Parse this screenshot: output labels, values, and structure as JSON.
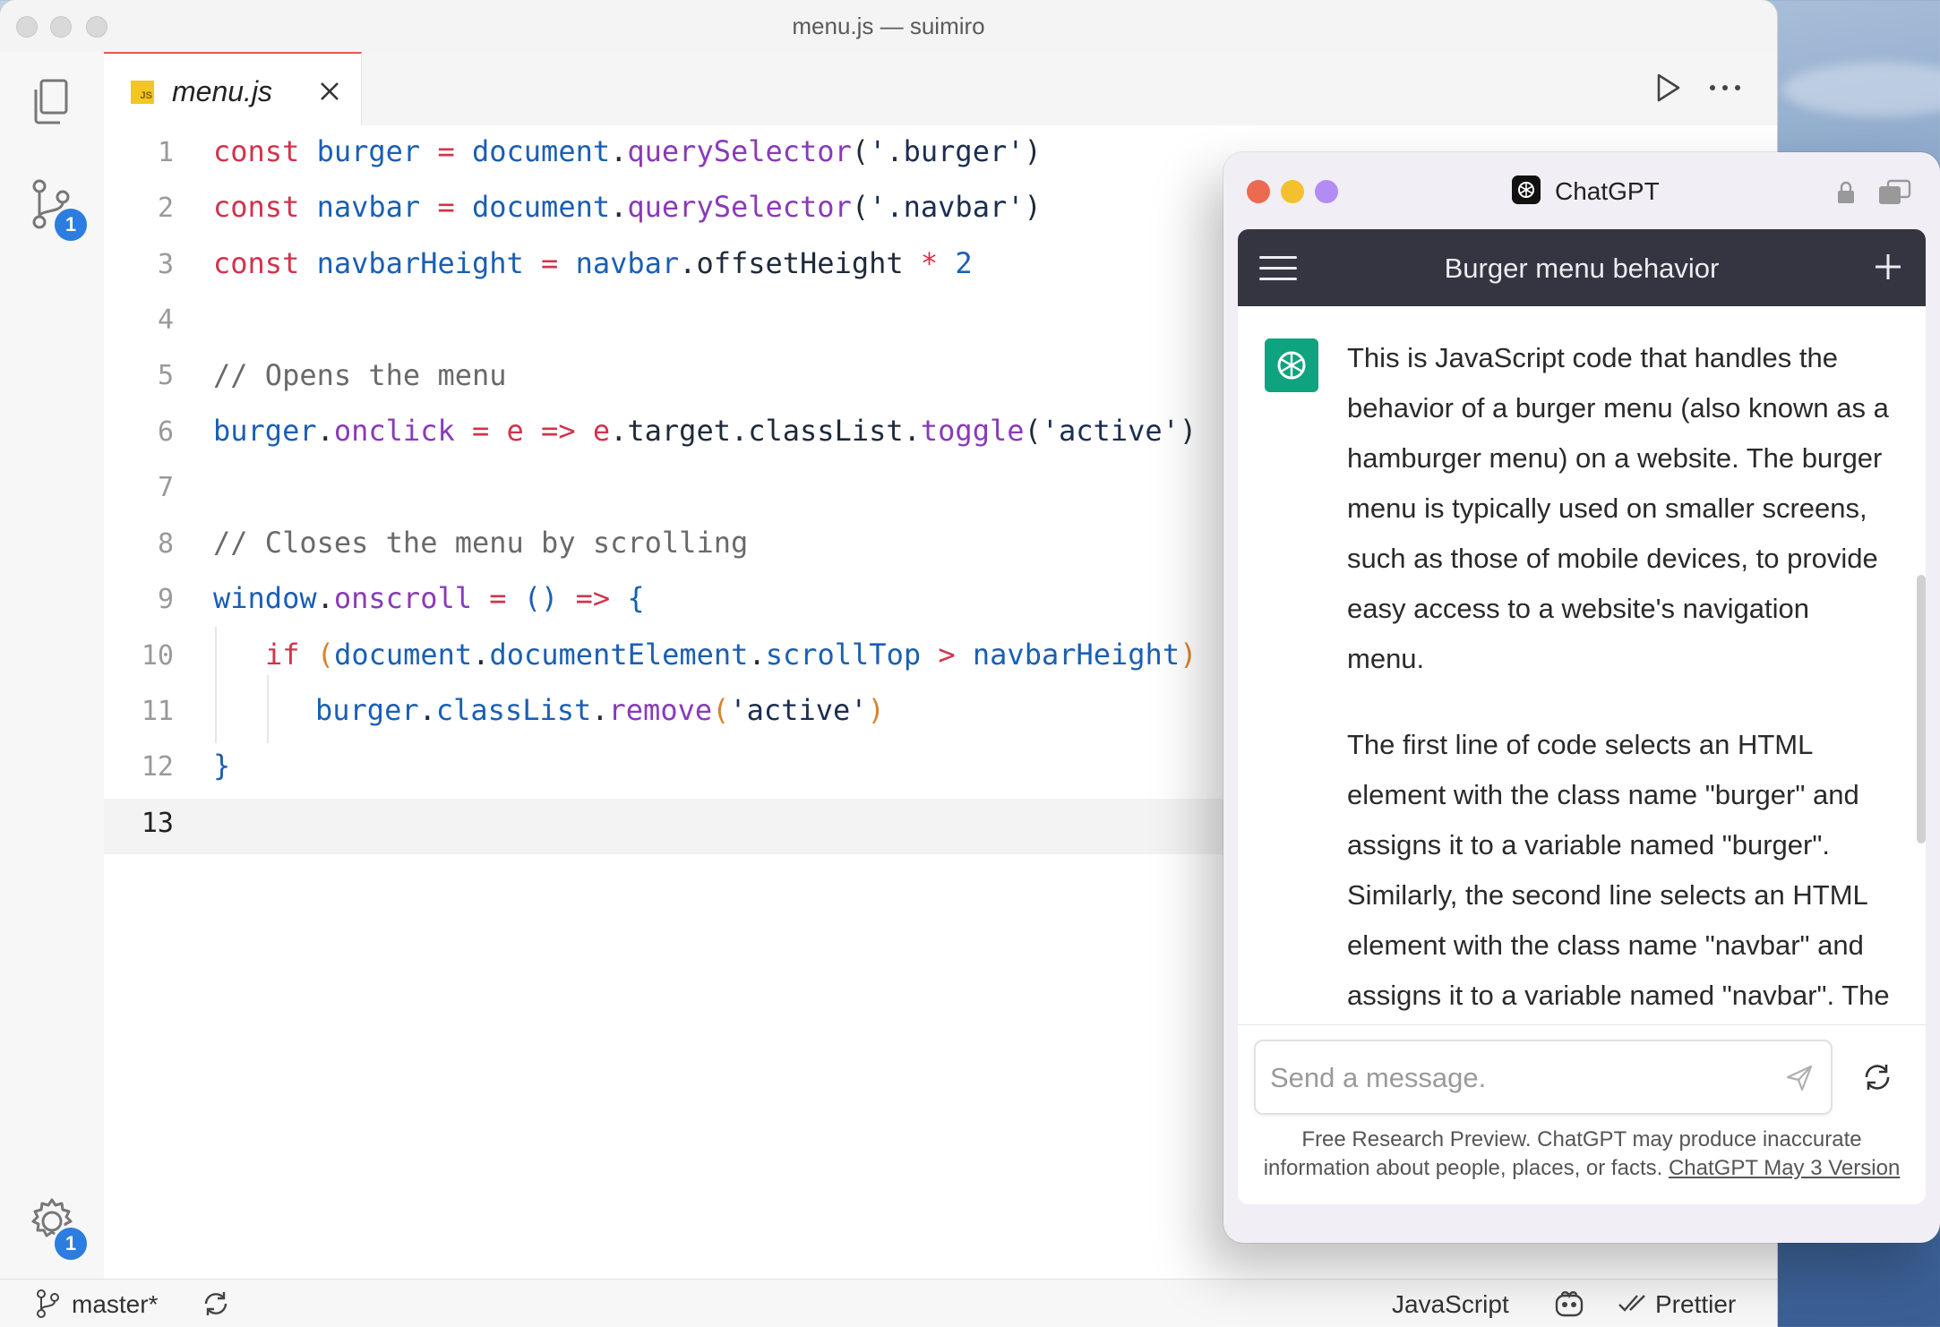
{
  "editor": {
    "window_title": "menu.js — suimiro",
    "tab": {
      "label": "menu.js",
      "lang_badge": "JS"
    },
    "activity_badges": {
      "source_control": "1",
      "settings": "1"
    },
    "lines": [
      {
        "n": "1"
      },
      {
        "n": "2"
      },
      {
        "n": "3"
      },
      {
        "n": "4"
      },
      {
        "n": "5"
      },
      {
        "n": "6"
      },
      {
        "n": "7"
      },
      {
        "n": "8"
      },
      {
        "n": "9"
      },
      {
        "n": "10"
      },
      {
        "n": "11"
      },
      {
        "n": "12"
      },
      {
        "n": "13"
      }
    ],
    "code": {
      "l1": [
        "const",
        "burger",
        "=",
        "document",
        ".",
        "querySelector",
        "(",
        "'.burger'",
        ")"
      ],
      "l2": [
        "const",
        "navbar",
        "=",
        "document",
        ".",
        "querySelector",
        "(",
        "'.navbar'",
        ")"
      ],
      "l3": [
        "const",
        "navbarHeight",
        "=",
        "navbar",
        ".offsetHeight",
        "*",
        "2"
      ],
      "l5": "// Opens the menu",
      "l6": [
        "burger",
        ".",
        "onclick",
        "=",
        "e",
        "=>",
        "e",
        ".target.classList.",
        "toggle",
        "(",
        "'active'",
        ")"
      ],
      "l8": "// Closes the menu by scrolling",
      "l9": [
        "window",
        ".",
        "onscroll",
        "=",
        "()",
        "=>",
        "{"
      ],
      "l10": [
        "if",
        "(",
        "document",
        ".",
        "documentElement",
        ".",
        "scrollTop",
        ">",
        "navbarHeight",
        ")"
      ],
      "l11": [
        "burger",
        ".",
        "classList",
        ".",
        "remove",
        "(",
        "'active'",
        ")"
      ],
      "l12": "}"
    },
    "status": {
      "branch": "master*",
      "language": "JavaScript",
      "formatter": "Prettier"
    }
  },
  "chat": {
    "app_title": "ChatGPT",
    "conversation_title": "Burger menu behavior",
    "paragraphs": [
      "This is JavaScript code that handles the behavior of a burger menu (also known as a hamburger menu) on a website. The burger menu is typically used on smaller screens, such as those of mobile devices, to provide easy access to a website's navigation menu.",
      "The first line of code selects an HTML element with the class name \"burger\" and assigns it to a variable named \"burger\". Similarly, the second line selects an HTML element with the class name \"navbar\" and assigns it to a variable named \"navbar\". The third line calculates"
    ],
    "input_placeholder": "Send a message.",
    "disclaimer": "Free Research Preview. ChatGPT may produce inaccurate information about people, places, or facts.",
    "version_link": "ChatGPT May 3 Version",
    "colors": {
      "header": "#343541",
      "avatar": "#10a37f",
      "dot_red": "#ec6a4f",
      "dot_yellow": "#f4c02e",
      "dot_purple": "#b38cf3"
    }
  }
}
